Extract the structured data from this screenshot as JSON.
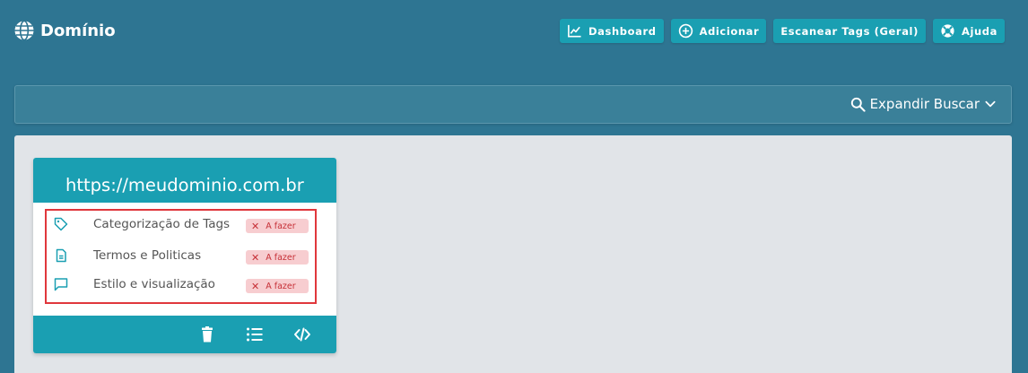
{
  "header": {
    "brand": "Domínio",
    "brand_icon": "globe-icon",
    "buttons": [
      {
        "label": "Dashboard",
        "icon": "chart-line-icon"
      },
      {
        "label": "Adicionar",
        "icon": "plus-circle-icon"
      },
      {
        "label": "Escanear Tags (Geral)",
        "icon": ""
      },
      {
        "label": "Ajuda",
        "icon": "life-ring-icon"
      }
    ]
  },
  "search": {
    "expand_label": "Expandir Buscar",
    "icon": "search-icon"
  },
  "card": {
    "domain": "https://meudominio.com.br",
    "items": [
      {
        "label": "Categorização de Tags",
        "icon": "tag-icon",
        "status": "A fazer"
      },
      {
        "label": "Termos e Politicas",
        "icon": "document-icon",
        "status": "A fazer"
      },
      {
        "label": "Estilo e visualização",
        "icon": "chat-icon",
        "status": "A fazer"
      }
    ],
    "footer_actions": [
      "trash-icon",
      "list-icon",
      "code-icon"
    ]
  },
  "colors": {
    "background": "#2e7592",
    "accent": "#1a9fb2",
    "content": "#e1e4e8",
    "status_bg": "#f7cdd0",
    "status_text": "#c62f36",
    "highlight_border": "#e0373c"
  }
}
